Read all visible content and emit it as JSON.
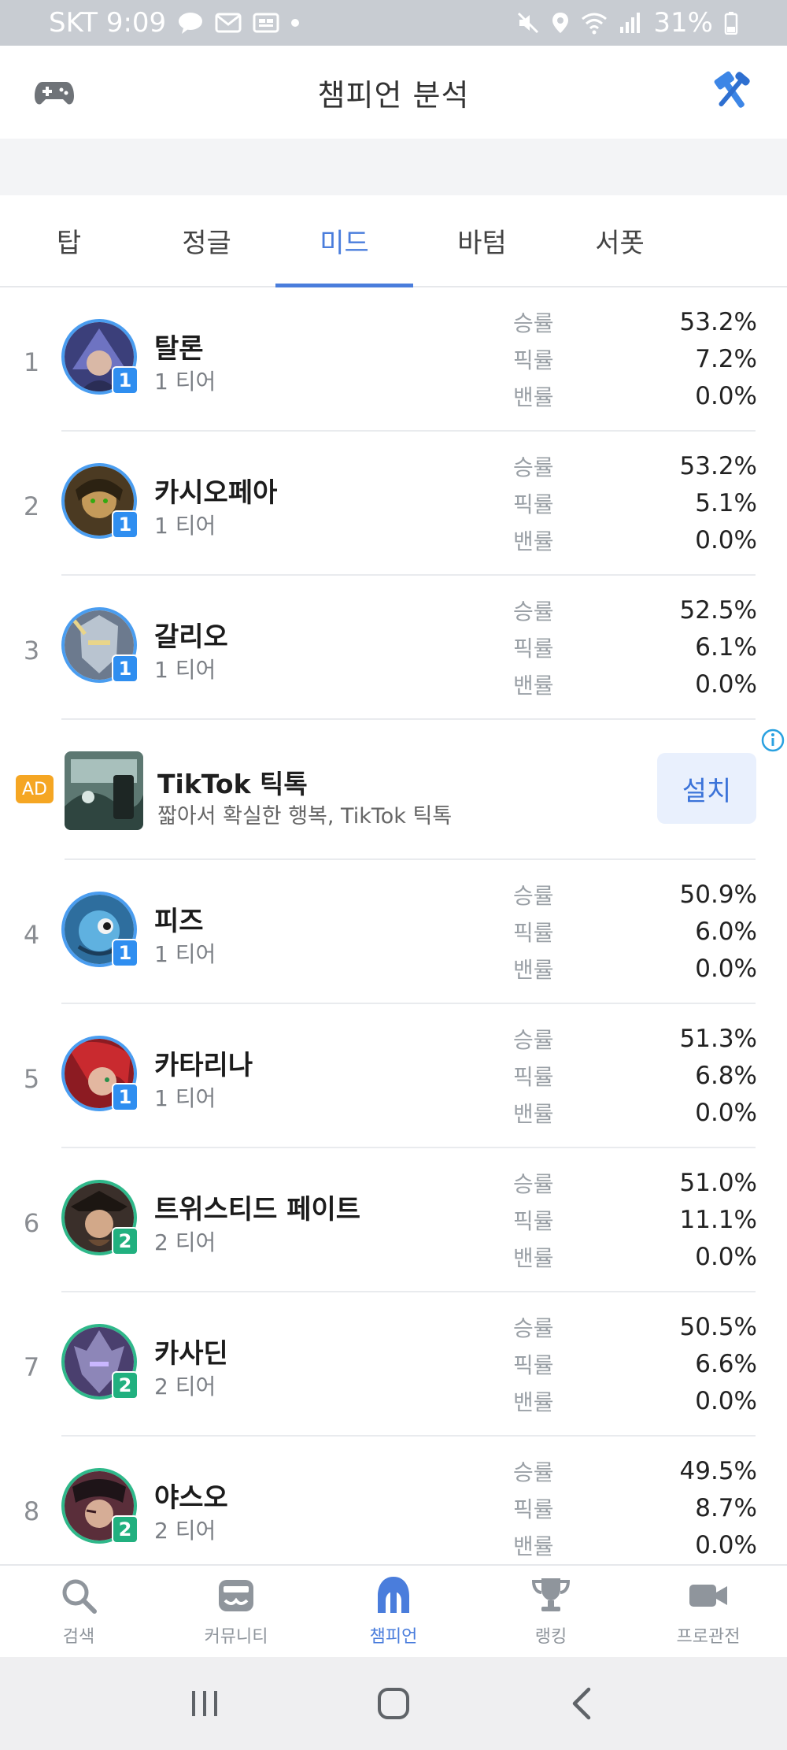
{
  "status_bar": {
    "carrier_time": "SKT 9:09",
    "battery": "31%"
  },
  "app_bar": {
    "title": "챔피언 분석"
  },
  "tabs": [
    {
      "label": "탑",
      "active": false
    },
    {
      "label": "정글",
      "active": false
    },
    {
      "label": "미드",
      "active": true
    },
    {
      "label": "바텀",
      "active": false
    },
    {
      "label": "서폿",
      "active": false
    }
  ],
  "stat_labels": {
    "win": "승률",
    "pick": "픽률",
    "ban": "밴률"
  },
  "champions": [
    {
      "rank": "1",
      "name": "탈론",
      "tier": "1 티어",
      "tier_num": "1",
      "win": "53.2%",
      "pick": "7.2%",
      "ban": "0.0%",
      "color": "#3b3f7a"
    },
    {
      "rank": "2",
      "name": "카시오페아",
      "tier": "1 티어",
      "tier_num": "1",
      "win": "53.2%",
      "pick": "5.1%",
      "ban": "0.0%",
      "color": "#4b3a22"
    },
    {
      "rank": "3",
      "name": "갈리오",
      "tier": "1 티어",
      "tier_num": "1",
      "win": "52.5%",
      "pick": "6.1%",
      "ban": "0.0%",
      "color": "#6c7a8e"
    },
    {
      "rank": "4",
      "name": "피즈",
      "tier": "1 티어",
      "tier_num": "1",
      "win": "50.9%",
      "pick": "6.0%",
      "ban": "0.0%",
      "color": "#2e6e9e"
    },
    {
      "rank": "5",
      "name": "카타리나",
      "tier": "1 티어",
      "tier_num": "1",
      "win": "51.3%",
      "pick": "6.8%",
      "ban": "0.0%",
      "color": "#8c1b22"
    },
    {
      "rank": "6",
      "name": "트위스티드 페이트",
      "tier": "2 티어",
      "tier_num": "2",
      "win": "51.0%",
      "pick": "11.1%",
      "ban": "0.0%",
      "color": "#3a2f2a"
    },
    {
      "rank": "7",
      "name": "카사딘",
      "tier": "2 티어",
      "tier_num": "2",
      "win": "50.5%",
      "pick": "6.6%",
      "ban": "0.0%",
      "color": "#4a3f6e"
    },
    {
      "rank": "8",
      "name": "야스오",
      "tier": "2 티어",
      "tier_num": "2",
      "win": "49.5%",
      "pick": "8.7%",
      "ban": "0.0%",
      "color": "#5a2e3a"
    }
  ],
  "ad": {
    "tag": "AD",
    "title": "TikTok 틱톡",
    "subtitle": "짧아서 확실한 행복, TikTok 틱톡",
    "install_label": "설치"
  },
  "bottom_nav": [
    {
      "label": "검색",
      "icon": "search-icon",
      "active": false
    },
    {
      "label": "커뮤니티",
      "icon": "community-icon",
      "active": false
    },
    {
      "label": "챔피언",
      "icon": "champion-helmet-icon",
      "active": true
    },
    {
      "label": "랭킹",
      "icon": "trophy-icon",
      "active": false
    },
    {
      "label": "프로관전",
      "icon": "video-camera-icon",
      "active": false
    }
  ],
  "colors": {
    "accent": "#4a7ddc",
    "tier1": "#2f8ef0",
    "tier2": "#21b07f",
    "ad_tag": "#f5a623"
  }
}
